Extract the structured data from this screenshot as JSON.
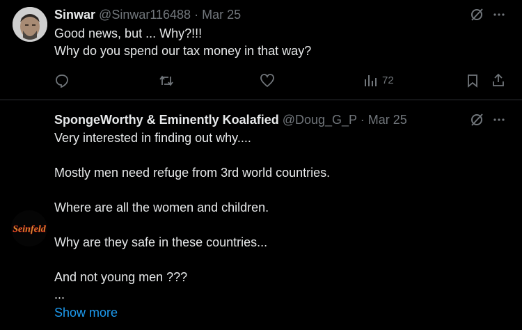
{
  "tweets": [
    {
      "display_name": "Sinwar",
      "handle": "@Sinwar116488",
      "separator": "·",
      "date": "Mar 25",
      "text": "Good news, but ... Why?!!!\nWhy do you spend our tax money in that way?",
      "views": "72",
      "icons": [
        "grok-icon",
        "more-icon",
        "reply-icon",
        "retweet-icon",
        "like-icon",
        "views-icon",
        "bookmark-icon",
        "share-icon"
      ]
    },
    {
      "display_name": "SpongeWorthy & Eminently Koalafied",
      "handle": "@Doug_G_P",
      "separator": "·",
      "date": "Mar 25",
      "avatar_text": "Seinfeld",
      "text": "Very interested in finding out why....\n\nMostly men need refuge from 3rd world countries.\n\nWhere are all the women and children.\n\nWhy are they safe in these countries...\n\nAnd not young men ???\n...",
      "show_more": "Show more",
      "icons": [
        "grok-icon",
        "more-icon"
      ]
    }
  ],
  "colors": {
    "background": "#000000",
    "text": "#e7e9ea",
    "muted": "#71767b",
    "link": "#1d9bf0",
    "divider": "#2f3336"
  }
}
